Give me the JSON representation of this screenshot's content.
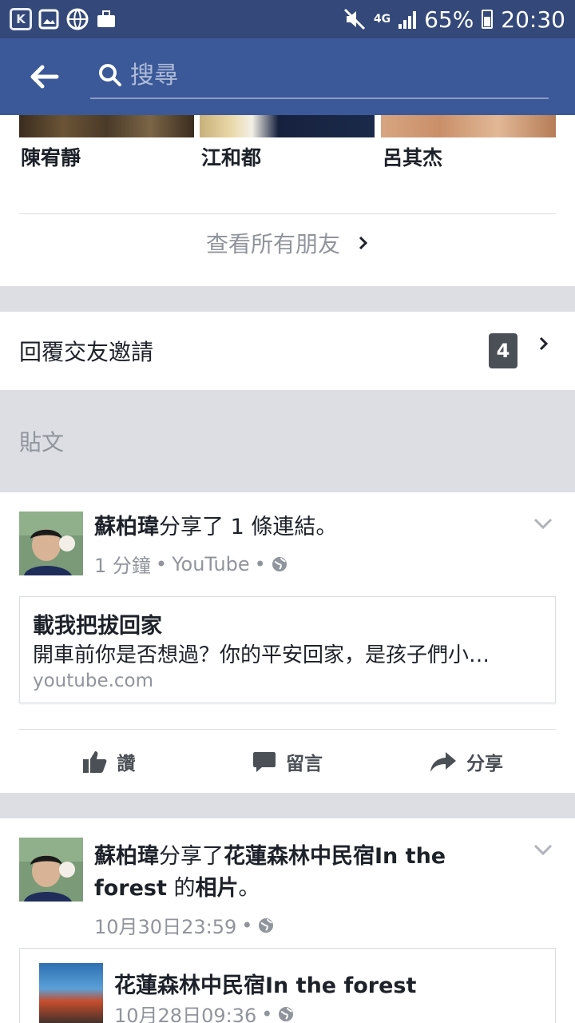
{
  "status_bar": {
    "network": "4G",
    "battery": "65%",
    "time": "20:30"
  },
  "header": {
    "search_placeholder": "搜尋"
  },
  "friends": {
    "items": [
      {
        "name": "陳宥靜"
      },
      {
        "name": "江和都"
      },
      {
        "name": "呂其杰"
      }
    ],
    "see_all": "查看所有朋友"
  },
  "requests": {
    "label": "回覆交友邀請",
    "count": "4"
  },
  "posts_section": {
    "label": "貼文"
  },
  "post1": {
    "author": "蘇柏瑋",
    "action": "分享了 1 條連結。",
    "time": "1 分鐘",
    "source": "YouTube",
    "link": {
      "title": "載我把拔回家",
      "description": "開車前你是否想過？你的平安回家，是孩子們小…",
      "domain": "youtube.com"
    },
    "actions": {
      "like": "讚",
      "comment": "留言",
      "share": "分享"
    }
  },
  "post2": {
    "author": "蘇柏瑋",
    "action_prefix": "分享了",
    "page_name": "花蓮森林中民宿In the forest",
    "action_suffix": " 的",
    "object": "相片",
    "period": "。",
    "time": "10月30日23:59",
    "shared": {
      "title": "花蓮森林中民宿In the forest",
      "time": "10月28日09:36"
    }
  },
  "colors": {
    "status_bar": "#34497a",
    "header": "#3b5998",
    "divider": "#dcdee3"
  }
}
